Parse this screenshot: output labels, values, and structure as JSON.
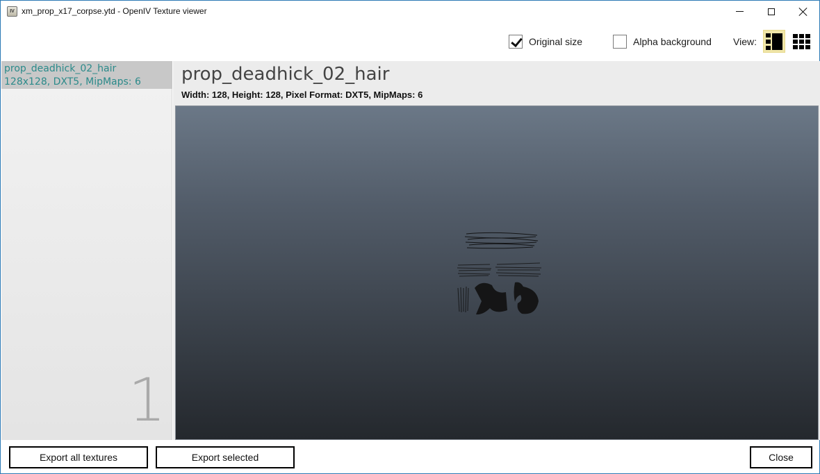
{
  "window": {
    "title": "xm_prop_x17_corpse.ytd - OpenIV Texture viewer",
    "app_icon_label": "IV",
    "controls": [
      "minimize",
      "maximize",
      "close"
    ]
  },
  "toolbar": {
    "original_size": {
      "label": "Original size",
      "checked": true
    },
    "alpha_background": {
      "label": "Alpha background",
      "checked": false
    },
    "view_label": "View:",
    "view_modes": [
      {
        "name": "list-view",
        "active": true
      },
      {
        "name": "grid-view",
        "active": false
      }
    ],
    "active_view_color": "#f0e6a8"
  },
  "sidebar": {
    "textures": [
      {
        "name": "prop_deadhick_02_hair",
        "summary": "128x128, DXT5, MipMaps: 6",
        "selected": true
      }
    ],
    "count": "1",
    "item_text_color": "#2b8a8a"
  },
  "main": {
    "texture_name": "prop_deadhick_02_hair",
    "texture_info": "Width: 128, Height: 128, Pixel Format: DXT5, MipMaps: 6",
    "preview_alt": "hair texture preview"
  },
  "footer": {
    "export_all_label": "Export all textures",
    "export_selected_label": "Export selected",
    "close_label": "Close"
  }
}
